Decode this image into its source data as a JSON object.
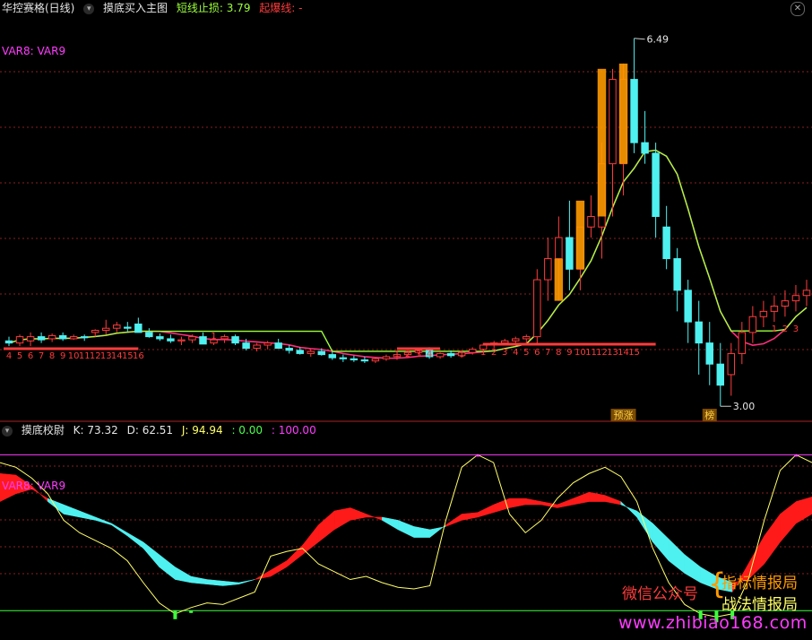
{
  "main_header": {
    "stock_name": "华控赛格(日线)",
    "indicator_name": "摸底买入主图",
    "stop_loss_label": "短线止损: 3.79",
    "start_line_label": "起爆线: -",
    "var_legend": "VAR8: VAR9"
  },
  "sub_header": {
    "indicator_name": "摸底校尉",
    "k_label": "K: 73.32",
    "d_label": "D: 62.51",
    "j_label": "J: 94.94",
    "extra1": ": 0.00",
    "extra2": ": 100.00",
    "var_legend": "VAR8: VAR9"
  },
  "markers": {
    "high_label": "6.49",
    "low_label": "3.00",
    "tag_yuzhang": "预涨",
    "tag_bang": "榜"
  },
  "watermark": {
    "line1": "微信公众号",
    "line2_top": "指标情报局",
    "line2_bottom": "战法情报局",
    "url": "www.zhibiao168.com"
  },
  "colors": {
    "up": "#ff3b3b",
    "down": "#4ff0f0",
    "ma_pink": "#ff2d7a",
    "stop_green": "#9cff3a",
    "grid_red": "#8a1f1f",
    "magenta": "#ff3cff",
    "orange": "#ff9a00",
    "k_yellow": "#ffff66"
  },
  "chart_data": [
    {
      "type": "candlestick",
      "title": "摸底买入主图",
      "candles": [
        [
          3.62,
          3.66,
          3.57,
          3.6
        ],
        [
          3.6,
          3.68,
          3.57,
          3.66
        ],
        [
          3.62,
          3.7,
          3.57,
          3.66
        ],
        [
          3.66,
          3.7,
          3.6,
          3.63
        ],
        [
          3.64,
          3.69,
          3.61,
          3.67
        ],
        [
          3.67,
          3.7,
          3.62,
          3.64
        ],
        [
          3.64,
          3.68,
          3.63,
          3.66
        ],
        [
          3.66,
          3.68,
          3.62,
          3.65
        ],
        [
          3.7,
          3.73,
          3.66,
          3.72
        ],
        [
          3.72,
          3.82,
          3.68,
          3.74
        ],
        [
          3.74,
          3.8,
          3.7,
          3.77
        ],
        [
          3.75,
          3.8,
          3.71,
          3.74
        ],
        [
          3.78,
          3.84,
          3.74,
          3.7
        ],
        [
          3.7,
          3.74,
          3.65,
          3.66
        ],
        [
          3.66,
          3.69,
          3.62,
          3.64
        ],
        [
          3.64,
          3.68,
          3.6,
          3.62
        ],
        [
          3.62,
          3.66,
          3.58,
          3.63
        ],
        [
          3.63,
          3.68,
          3.6,
          3.66
        ],
        [
          3.66,
          3.7,
          3.6,
          3.59
        ],
        [
          3.6,
          3.66,
          3.58,
          3.63
        ],
        [
          3.64,
          3.68,
          3.6,
          3.66
        ],
        [
          3.66,
          3.68,
          3.58,
          3.6
        ],
        [
          3.6,
          3.64,
          3.53,
          3.55
        ],
        [
          3.55,
          3.6,
          3.52,
          3.58
        ],
        [
          3.58,
          3.62,
          3.54,
          3.6
        ],
        [
          3.6,
          3.64,
          3.56,
          3.55
        ],
        [
          3.55,
          3.58,
          3.5,
          3.53
        ],
        [
          3.53,
          3.56,
          3.49,
          3.5
        ],
        [
          3.5,
          3.54,
          3.47,
          3.52
        ],
        [
          3.52,
          3.55,
          3.48,
          3.49
        ],
        [
          3.49,
          3.52,
          3.44,
          3.46
        ],
        [
          3.46,
          3.49,
          3.42,
          3.45
        ],
        [
          3.45,
          3.48,
          3.42,
          3.44
        ],
        [
          3.44,
          3.47,
          3.41,
          3.43
        ],
        [
          3.43,
          3.47,
          3.41,
          3.45
        ],
        [
          3.45,
          3.49,
          3.43,
          3.47
        ],
        [
          3.47,
          3.51,
          3.44,
          3.49
        ],
        [
          3.49,
          3.53,
          3.46,
          3.51
        ],
        [
          3.51,
          3.55,
          3.48,
          3.53
        ],
        [
          3.53,
          3.56,
          3.45,
          3.47
        ],
        [
          3.47,
          3.51,
          3.45,
          3.5
        ],
        [
          3.5,
          3.53,
          3.46,
          3.48
        ],
        [
          3.48,
          3.52,
          3.46,
          3.51
        ],
        [
          3.51,
          3.56,
          3.49,
          3.54
        ],
        [
          3.54,
          3.6,
          3.52,
          3.58
        ],
        [
          3.58,
          3.62,
          3.55,
          3.6
        ],
        [
          3.6,
          3.64,
          3.58,
          3.62
        ],
        [
          3.62,
          3.66,
          3.6,
          3.64
        ],
        [
          3.64,
          3.68,
          3.6,
          3.66
        ],
        [
          3.66,
          4.3,
          3.6,
          4.2
        ],
        [
          4.2,
          4.6,
          4.0,
          4.4
        ],
        [
          4.4,
          4.8,
          4.0,
          4.6
        ],
        [
          4.6,
          4.95,
          4.1,
          4.3
        ],
        [
          4.3,
          4.7,
          4.1,
          4.7
        ],
        [
          4.7,
          5.0,
          4.6,
          4.8
        ],
        [
          4.7,
          5.5,
          4.4,
          5.3
        ],
        [
          5.3,
          6.2,
          4.8,
          6.1
        ],
        [
          5.3,
          6.25,
          5.0,
          6.1
        ],
        [
          6.1,
          6.49,
          5.4,
          5.5
        ],
        [
          5.5,
          5.8,
          5.3,
          5.4
        ],
        [
          5.4,
          5.5,
          4.6,
          4.8
        ],
        [
          4.7,
          4.9,
          4.3,
          4.4
        ],
        [
          4.4,
          4.5,
          3.9,
          4.1
        ],
        [
          4.1,
          4.2,
          3.6,
          3.8
        ],
        [
          3.8,
          4.0,
          3.3,
          3.6
        ],
        [
          3.6,
          3.8,
          3.2,
          3.4
        ],
        [
          3.4,
          3.6,
          3.0,
          3.2
        ],
        [
          3.3,
          3.6,
          3.1,
          3.5
        ],
        [
          3.5,
          3.8,
          3.4,
          3.7
        ],
        [
          3.7,
          3.95,
          3.6,
          3.85
        ],
        [
          3.85,
          4.0,
          3.75,
          3.9
        ],
        [
          3.9,
          4.05,
          3.8,
          3.95
        ],
        [
          3.95,
          4.1,
          3.85,
          4.0
        ],
        [
          4.0,
          4.15,
          3.9,
          4.05
        ],
        [
          4.05,
          4.2,
          3.95,
          4.1
        ]
      ],
      "orange_bars": [
        [
          4.0,
          4.4
        ],
        [
          4.3,
          4.95
        ],
        [
          4.8,
          6.2
        ],
        [
          5.3,
          6.25
        ]
      ],
      "ylim": [
        2.9,
        6.7
      ],
      "count_labels_left": [
        "4",
        "5",
        "6",
        "7",
        "8",
        "9",
        "10",
        "11",
        "12",
        "13",
        "14",
        "15",
        "16"
      ],
      "count_labels_1": [
        "1"
      ],
      "count_labels_2": [
        "1",
        "2",
        "3",
        "4"
      ],
      "count_labels_3": [
        "1"
      ],
      "count_labels_4": [
        "1",
        "2",
        "3",
        "4",
        "5",
        "6",
        "7",
        "8",
        "9",
        "10",
        "11",
        "12",
        "13",
        "14",
        "15"
      ],
      "count_labels_5": [
        "1",
        "2",
        "3"
      ]
    },
    {
      "type": "area",
      "title": "摸底校尉",
      "ylim": [
        -5,
        110
      ],
      "k": [
        88,
        87,
        80,
        70,
        62,
        60,
        58,
        55,
        48,
        40,
        28,
        20,
        18,
        17,
        16,
        17,
        20,
        26,
        32,
        42,
        55,
        64,
        66,
        62,
        58,
        52,
        47,
        47,
        55,
        62,
        63,
        68,
        72,
        72,
        70,
        68,
        72,
        76,
        74,
        70,
        60,
        44,
        32,
        24,
        18,
        14,
        12,
        30,
        48,
        62,
        70,
        73
      ],
      "d": [
        70,
        75,
        78,
        72,
        68,
        64,
        60,
        56,
        50,
        44,
        36,
        28,
        22,
        20,
        19,
        18,
        20,
        22,
        28,
        36,
        44,
        52,
        58,
        60,
        60,
        58,
        54,
        52,
        54,
        58,
        60,
        63,
        66,
        68,
        68,
        66,
        68,
        70,
        70,
        68,
        64,
        56,
        46,
        36,
        28,
        22,
        18,
        20,
        30,
        44,
        56,
        62
      ],
      "j": [
        95,
        92,
        85,
        75,
        58,
        50,
        45,
        40,
        32,
        18,
        5,
        -2,
        2,
        5,
        4,
        8,
        12,
        35,
        38,
        40,
        30,
        25,
        20,
        22,
        18,
        15,
        14,
        16,
        58,
        92,
        100,
        95,
        62,
        50,
        58,
        72,
        82,
        88,
        92,
        86,
        70,
        40,
        18,
        4,
        -2,
        -4,
        -2,
        20,
        58,
        90,
        100,
        95
      ],
      "ref_lines": [
        0,
        100
      ]
    }
  ]
}
